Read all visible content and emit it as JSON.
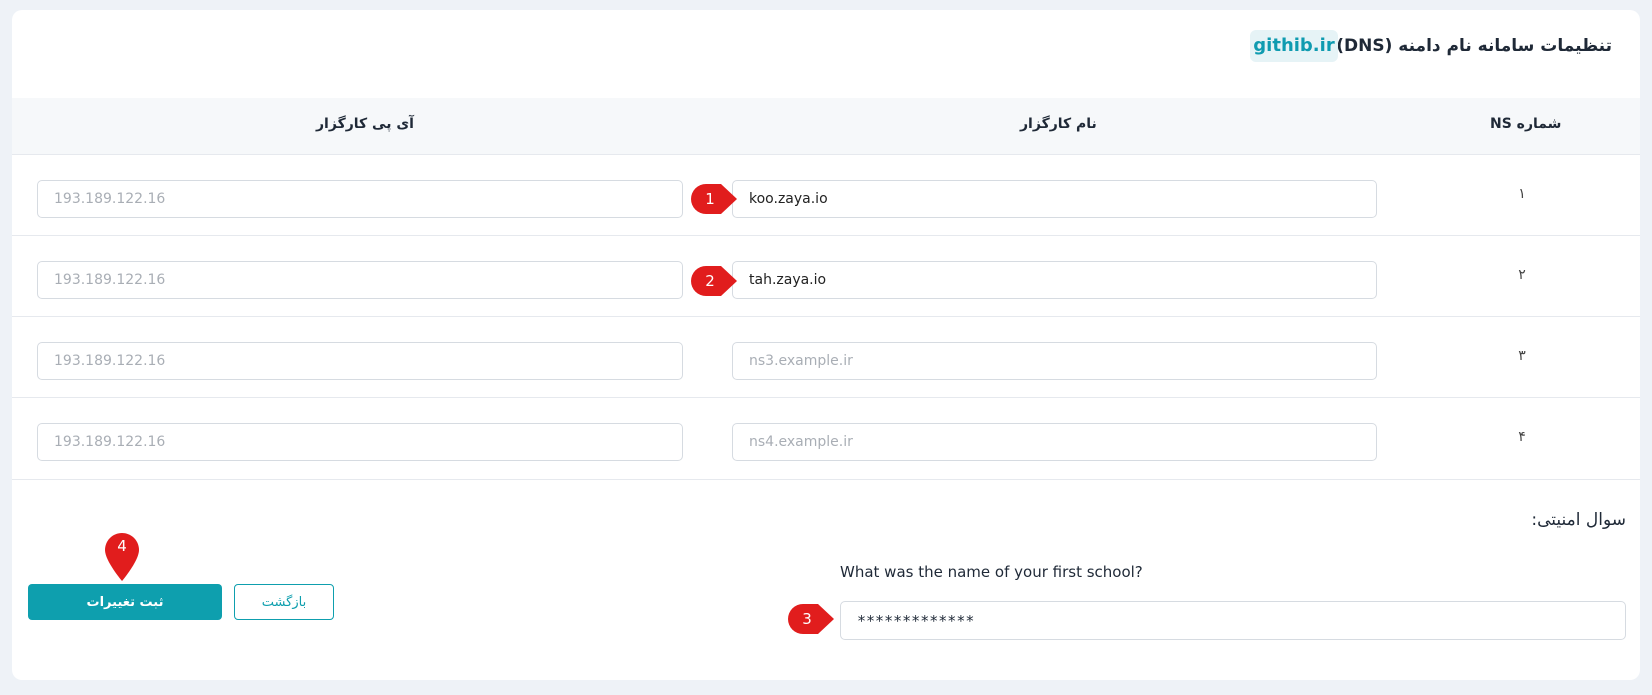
{
  "header": {
    "title": "تنظیمات سامانه نام دامنه (DNS)",
    "domain": "githib.ir"
  },
  "table": {
    "columns": [
      "شماره NS",
      "نام کارگزار",
      "آی پی کارگزار"
    ],
    "rows": [
      {
        "number": "۱",
        "name_value": "koo.zaya.io",
        "name_placeholder": "",
        "ip_placeholder": "193.189.122.16"
      },
      {
        "number": "۲",
        "name_value": "tah.zaya.io",
        "name_placeholder": "",
        "ip_placeholder": "193.189.122.16"
      },
      {
        "number": "۳",
        "name_value": "",
        "name_placeholder": "ns3.example.ir",
        "ip_placeholder": "193.189.122.16"
      },
      {
        "number": "۴",
        "name_value": "",
        "name_placeholder": "ns4.example.ir",
        "ip_placeholder": "193.189.122.16"
      }
    ]
  },
  "security": {
    "title": "سوال امنیتی:",
    "question": "What was the name of your first school?",
    "answer_value": "*************"
  },
  "buttons": {
    "submit": "ثبت تغییرات",
    "back": "بازگشت"
  },
  "markers": [
    "1",
    "2",
    "3",
    "4"
  ],
  "colors": {
    "accent": "#0e9fae",
    "marker": "#e11d1d",
    "badge_bg": "#e6f3f6"
  }
}
